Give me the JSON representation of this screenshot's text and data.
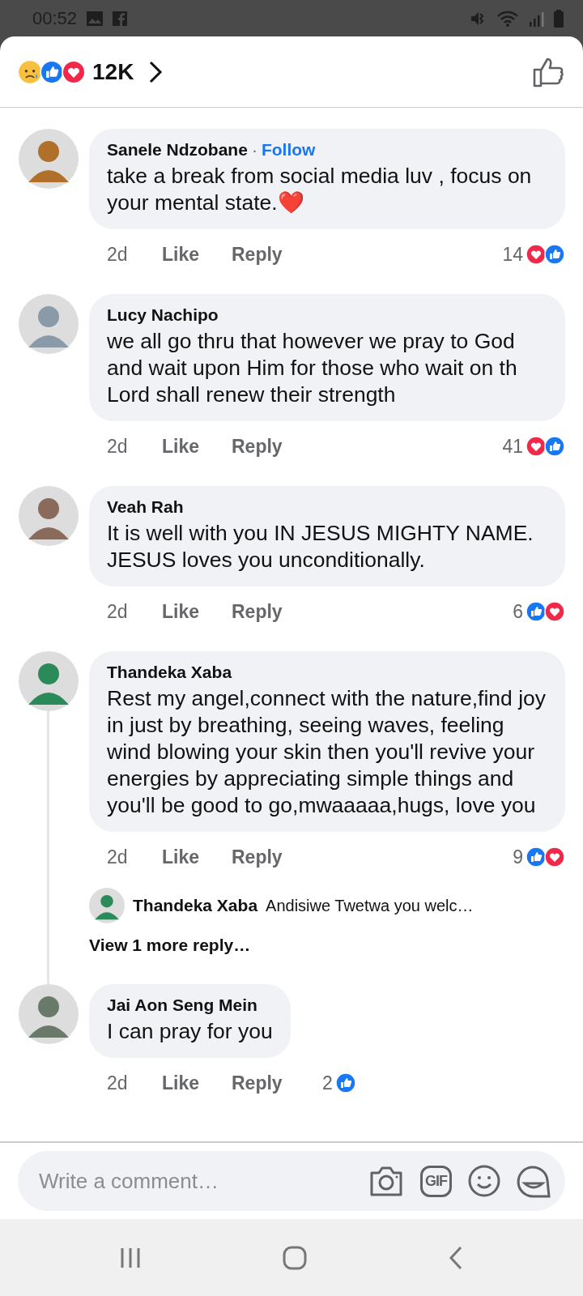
{
  "status_bar": {
    "time": "00:52"
  },
  "header": {
    "reactions": [
      {
        "kind": "sad"
      },
      {
        "kind": "like"
      },
      {
        "kind": "love"
      }
    ],
    "count": "12K"
  },
  "comments": [
    {
      "author": "Sanele Ndzobane",
      "separator": "·",
      "follow": "Follow",
      "text": "take a break from social media luv , focus on your mental state.❤️",
      "time": "2d",
      "like": "Like",
      "reply": "Reply",
      "count": "14",
      "reactions": [
        {
          "kind": "love"
        },
        {
          "kind": "like"
        }
      ]
    },
    {
      "author": "Lucy Nachipo",
      "text": "we all go thru that however we pray to God and wait upon Him for those who wait on th Lord shall renew their strength",
      "time": "2d",
      "like": "Like",
      "reply": "Reply",
      "count": "41",
      "reactions": [
        {
          "kind": "love"
        },
        {
          "kind": "like"
        }
      ]
    },
    {
      "author": "Veah Rah",
      "text": "It is well with you IN JESUS MIGHTY NAME. JESUS loves you unconditionally.",
      "time": "2d",
      "like": "Like",
      "reply": "Reply",
      "count": "6",
      "reactions": [
        {
          "kind": "like"
        },
        {
          "kind": "love"
        }
      ]
    },
    {
      "author": "Thandeka Xaba",
      "text": "Rest my angel,connect with the nature,find joy in just by breathing, seeing waves, feeling wind blowing your skin then you'll revive your energies by appreciating simple things and you'll be good to go,mwaaaaa,hugs, love you",
      "time": "2d",
      "like": "Like",
      "reply": "Reply",
      "count": "9",
      "reactions": [
        {
          "kind": "like"
        },
        {
          "kind": "love"
        }
      ],
      "replies": {
        "author": "Thandeka Xaba",
        "text": "Andisiwe Twetwa you welc…",
        "more": "View 1 more reply…"
      }
    },
    {
      "author": "Jai Aon Seng Mein",
      "text": "I can pray for you",
      "time": "2d",
      "like": "Like",
      "reply": "Reply",
      "count": "2",
      "reactions": [
        {
          "kind": "like"
        }
      ]
    }
  ],
  "composer": {
    "placeholder": "Write a comment…",
    "gif": "GIF"
  }
}
